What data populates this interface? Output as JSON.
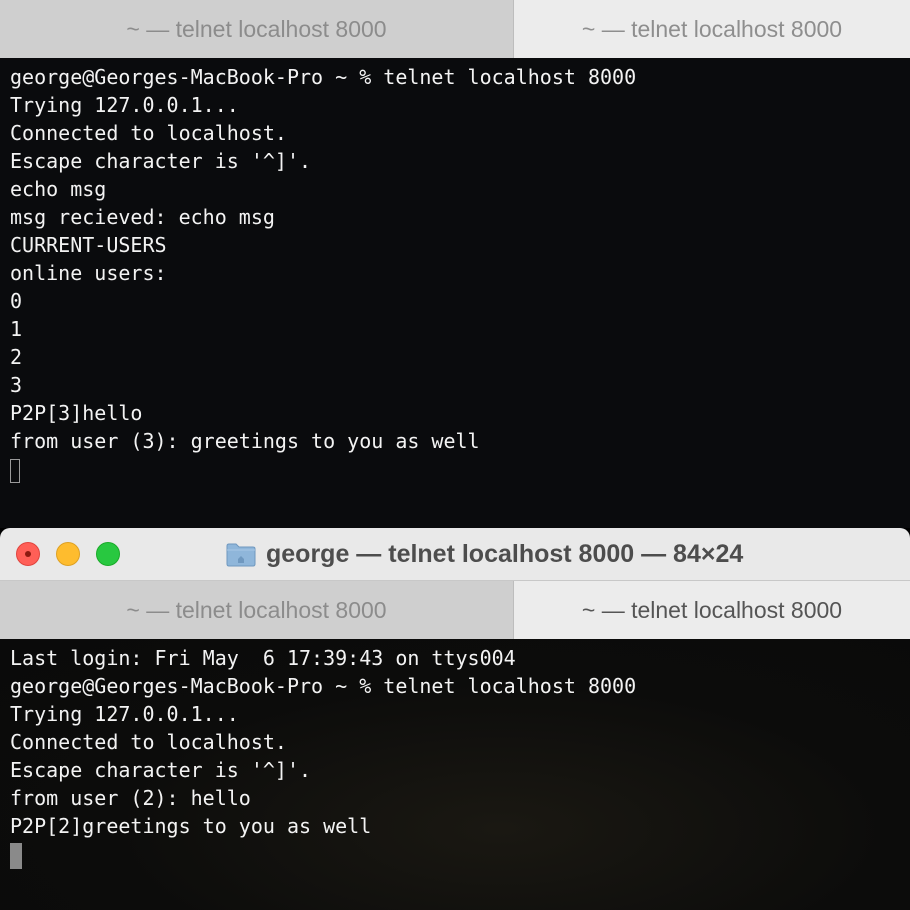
{
  "top_window": {
    "tabs": [
      {
        "label": "~ — telnet localhost 8000"
      },
      {
        "label": "~ — telnet localhost 8000"
      }
    ],
    "lines": [
      "george@Georges-MacBook-Pro ~ % telnet localhost 8000",
      "Trying 127.0.0.1...",
      "Connected to localhost.",
      "Escape character is '^]'.",
      "echo msg",
      "msg recieved: echo msg",
      "CURRENT-USERS",
      "online users:",
      "0",
      "1",
      "2",
      "3",
      "P2P[3]hello",
      "from user (3): greetings to you as well"
    ]
  },
  "bottom_window": {
    "title": "george — telnet localhost 8000 — 84×24",
    "tabs": [
      {
        "label": "~ — telnet localhost 8000"
      },
      {
        "label": "~ — telnet localhost 8000"
      }
    ],
    "lines": [
      "Last login: Fri May  6 17:39:43 on ttys004",
      "george@Georges-MacBook-Pro ~ % telnet localhost 8000",
      "Trying 127.0.0.1...",
      "Connected to localhost.",
      "Escape character is '^]'.",
      "from user (2): hello",
      "P2P[2]greetings to you as well"
    ]
  },
  "icons": {
    "close": "close-button-icon",
    "minimize": "minimize-button-icon",
    "maximize": "maximize-button-icon",
    "folder": "folder-icon"
  },
  "colors": {
    "terminal_bg": "#0a0b0d",
    "terminal_text": "#f3f3f3",
    "close": "#ff5f57",
    "minimize": "#febc2e",
    "maximize": "#28c840"
  }
}
